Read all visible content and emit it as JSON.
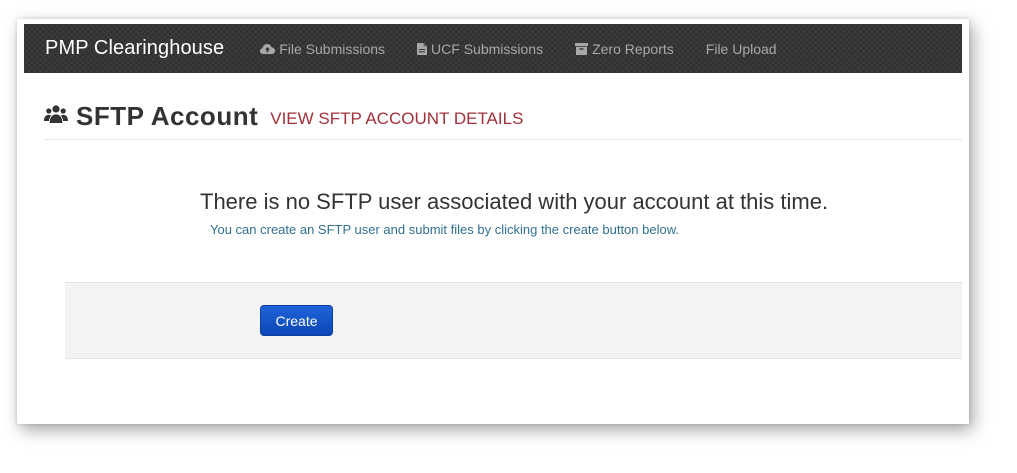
{
  "navbar": {
    "brand": "PMP Clearinghouse",
    "items": [
      {
        "label": "File Submissions",
        "icon": "cloud-upload-icon"
      },
      {
        "label": "UCF Submissions",
        "icon": "file-icon"
      },
      {
        "label": "Zero Reports",
        "icon": "archive-icon"
      },
      {
        "label": "File Upload",
        "icon": ""
      }
    ]
  },
  "header": {
    "icon": "users-icon",
    "title": "SFTP Account",
    "link": "VIEW SFTP ACCOUNT DETAILS"
  },
  "main": {
    "message": "There is no SFTP user associated with your account at this time.",
    "submessage": "You can create an SFTP user and submit files by clicking the create button below.",
    "create_label": "Create"
  },
  "colors": {
    "navbar_bg": "#2f2f2f",
    "link": "#a0303a",
    "info_text": "#31708f",
    "primary_button": "#1656c9",
    "well_bg": "#f3f3f3"
  }
}
